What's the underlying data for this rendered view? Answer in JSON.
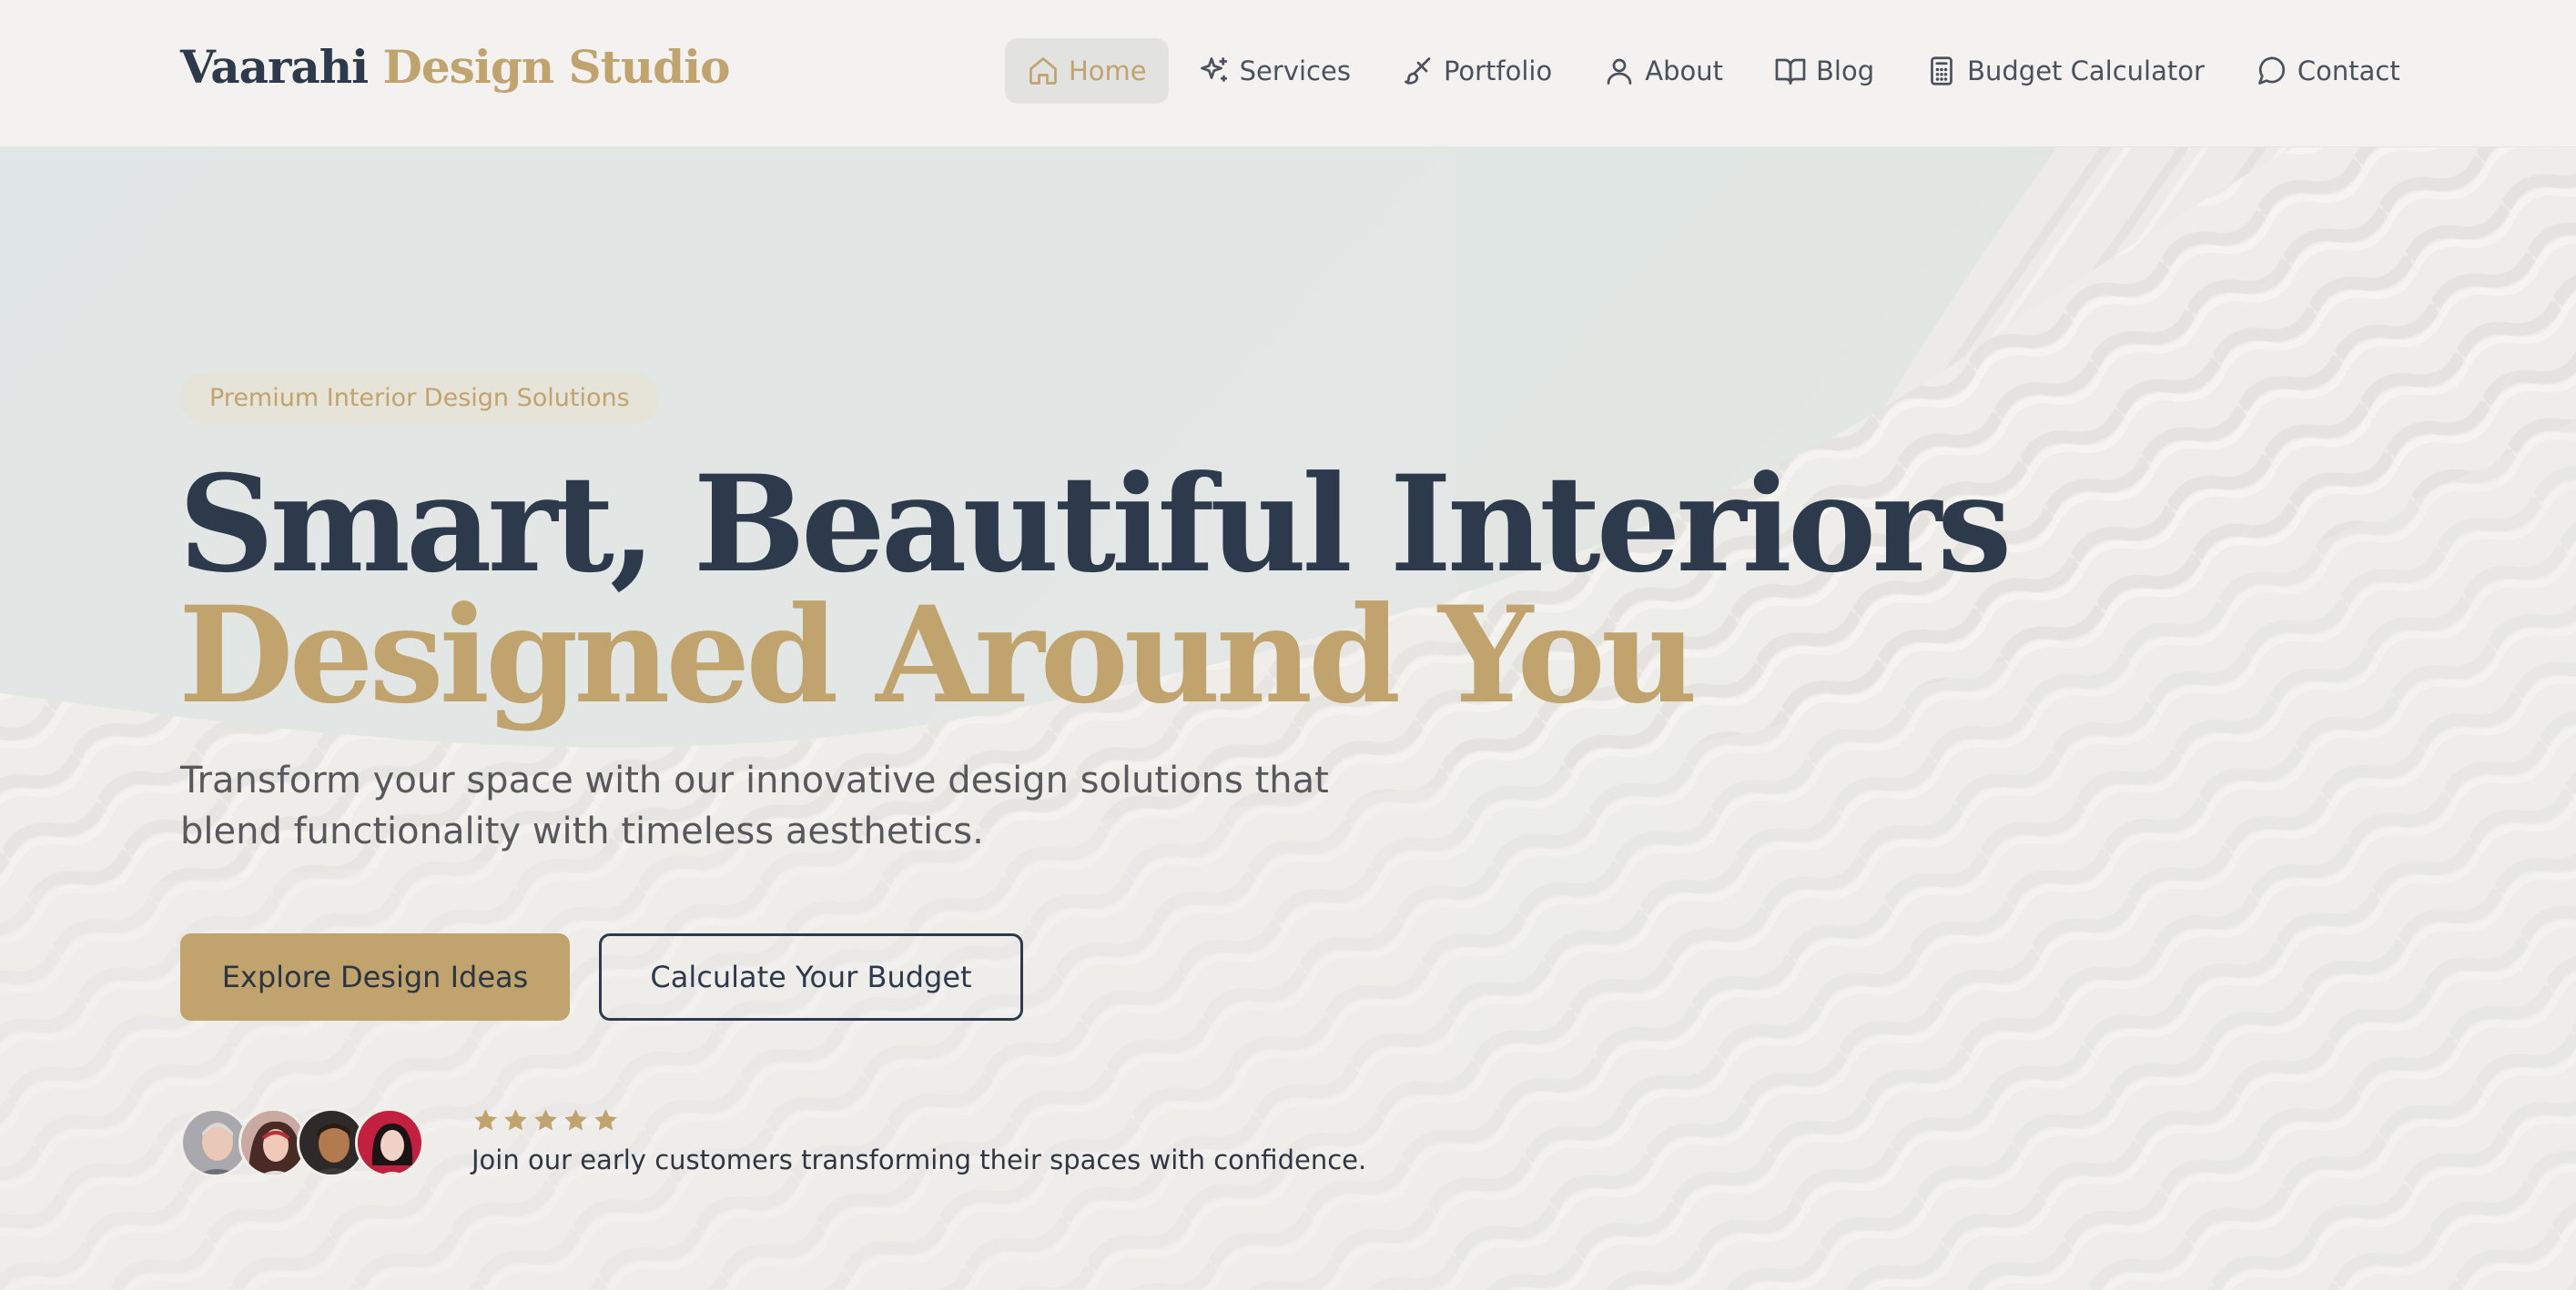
{
  "brand": {
    "part1": "Vaarahi",
    "part2": "Design Studio"
  },
  "nav": {
    "items": [
      {
        "label": "Home",
        "icon": "home-icon",
        "active": true
      },
      {
        "label": "Services",
        "icon": "sparkles-icon"
      },
      {
        "label": "Portfolio",
        "icon": "paintbrush-icon"
      },
      {
        "label": "About",
        "icon": "user-icon"
      },
      {
        "label": "Blog",
        "icon": "book-open-icon"
      },
      {
        "label": "Budget Calculator",
        "icon": "calculator-icon"
      },
      {
        "label": "Contact",
        "icon": "message-circle-icon"
      }
    ]
  },
  "hero": {
    "badge": "Premium Interior Design Solutions",
    "headline_line1": "Smart, Beautiful Interiors",
    "headline_line2": "Designed Around You",
    "subtitle": "Transform your space with our innovative design solutions that blend functionality with timeless aesthetics.",
    "primary_button": "Explore Design Ideas",
    "secondary_button": "Calculate Your Budget",
    "rating_stars": 5,
    "social_proof": "Join our early customers transforming their spaces with confidence."
  },
  "colors": {
    "navy": "#2d3a4b",
    "gold": "#c0a36d",
    "header_bg": "#f3f2f0",
    "active_nav_bg": "#e2e2e0"
  }
}
